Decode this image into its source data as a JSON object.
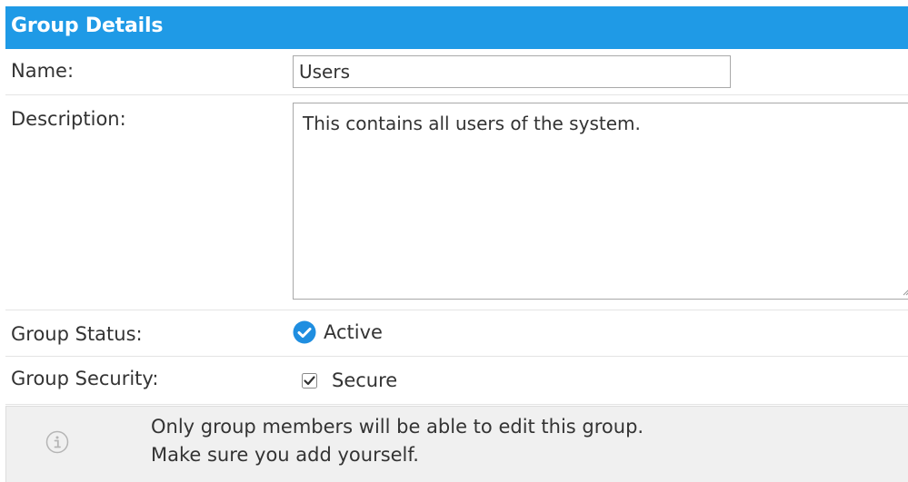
{
  "header": {
    "title": "Group Details"
  },
  "fields": {
    "name_label": "Name:",
    "name_value": "Users",
    "description_label": "Description:",
    "description_value": "This contains all users of the system.",
    "status_label": "Group Status:",
    "status_value": "Active",
    "security_label": "Group Security:",
    "security_value": "Secure",
    "security_checked": true
  },
  "note": {
    "line1": "Only group members will be able to edit this group.",
    "line2": "Make sure you add yourself."
  },
  "colors": {
    "header_bg": "#1f9ae6",
    "status_icon": "#1f8ee0",
    "note_bg": "#f0f0f0"
  },
  "icons": {
    "status": "check-circle-icon",
    "checkbox": "checkbox-checked-icon",
    "note": "info-icon"
  }
}
